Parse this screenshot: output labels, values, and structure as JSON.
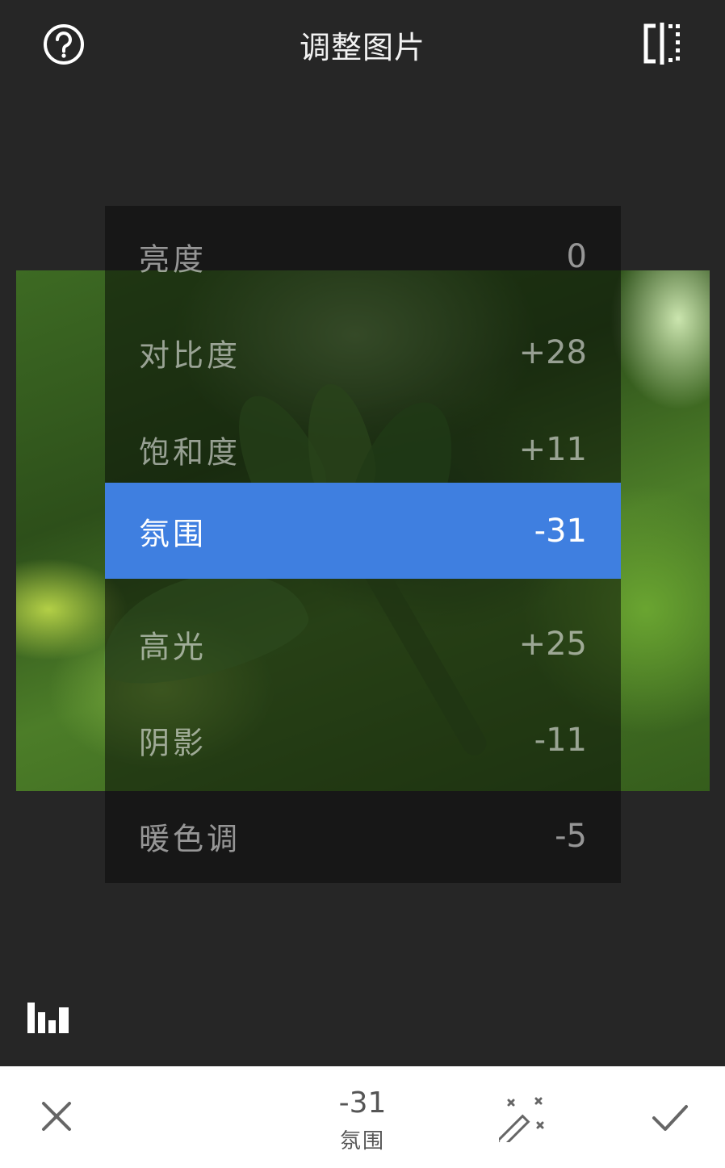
{
  "header": {
    "title": "调整图片",
    "help_icon": "help-circle-icon",
    "compare_icon": "compare-split-icon"
  },
  "adjustments": [
    {
      "label": "亮度",
      "value": "0"
    },
    {
      "label": "对比度",
      "value": "+28"
    },
    {
      "label": "饱和度",
      "value": "+11"
    },
    {
      "label": "氛围",
      "value": "-31",
      "selected": true
    },
    {
      "label": "高光",
      "value": "+25"
    },
    {
      "label": "阴影",
      "value": "-11"
    },
    {
      "label": "暖色调",
      "value": "-5"
    }
  ],
  "histogram_icon": "histogram-icon",
  "bottom_bar": {
    "cancel_icon": "close-icon",
    "current_value": "-31",
    "current_name": "氛围",
    "auto_icon": "magic-wand-icon",
    "apply_icon": "checkmark-icon"
  },
  "colors": {
    "accent": "#3f7fe0",
    "background": "#262626",
    "panel": "#171717"
  }
}
